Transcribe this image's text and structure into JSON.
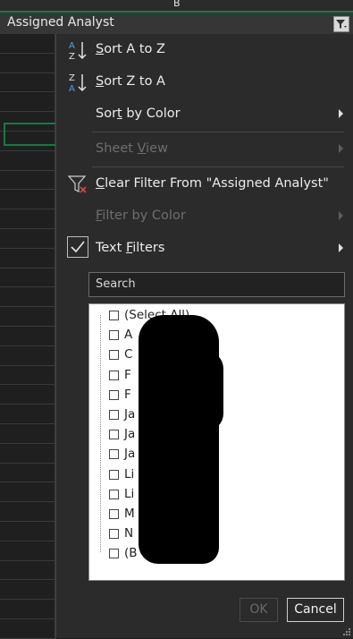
{
  "column_letter": "B",
  "header_cell": "Assigned Analyst",
  "menu": {
    "sort_az": {
      "pre": "",
      "key": "S",
      "post": "ort A to Z"
    },
    "sort_za": {
      "pre": "",
      "key": "S",
      "post": "ort Z to A"
    },
    "sort_color": {
      "pre": "Sor",
      "key": "t",
      "post": " by Color"
    },
    "sheet_view": {
      "pre": "Sheet ",
      "key": "V",
      "post": "iew"
    },
    "clear_filter": {
      "pre": "",
      "key": "C",
      "post": "lear Filter From \"Assigned Analyst\""
    },
    "filter_color": {
      "pre": "",
      "key": "F",
      "post": "ilter by Color"
    },
    "text_filters": {
      "pre": "",
      "key": "F",
      "post": "",
      "full": "Text Filters"
    }
  },
  "search": {
    "placeholder": "Search"
  },
  "list": {
    "items": [
      "(Select All)",
      "A",
      "C",
      "F",
      "F",
      "Ja",
      "Ja",
      "Ja",
      "Li",
      "Li",
      "M",
      "N",
      "(B"
    ]
  },
  "buttons": {
    "ok": "OK",
    "cancel": "Cancel"
  },
  "colors": {
    "accent": "#217346",
    "menu_bg": "#2b2b2b",
    "disabled_text": "#6e6e6e"
  }
}
